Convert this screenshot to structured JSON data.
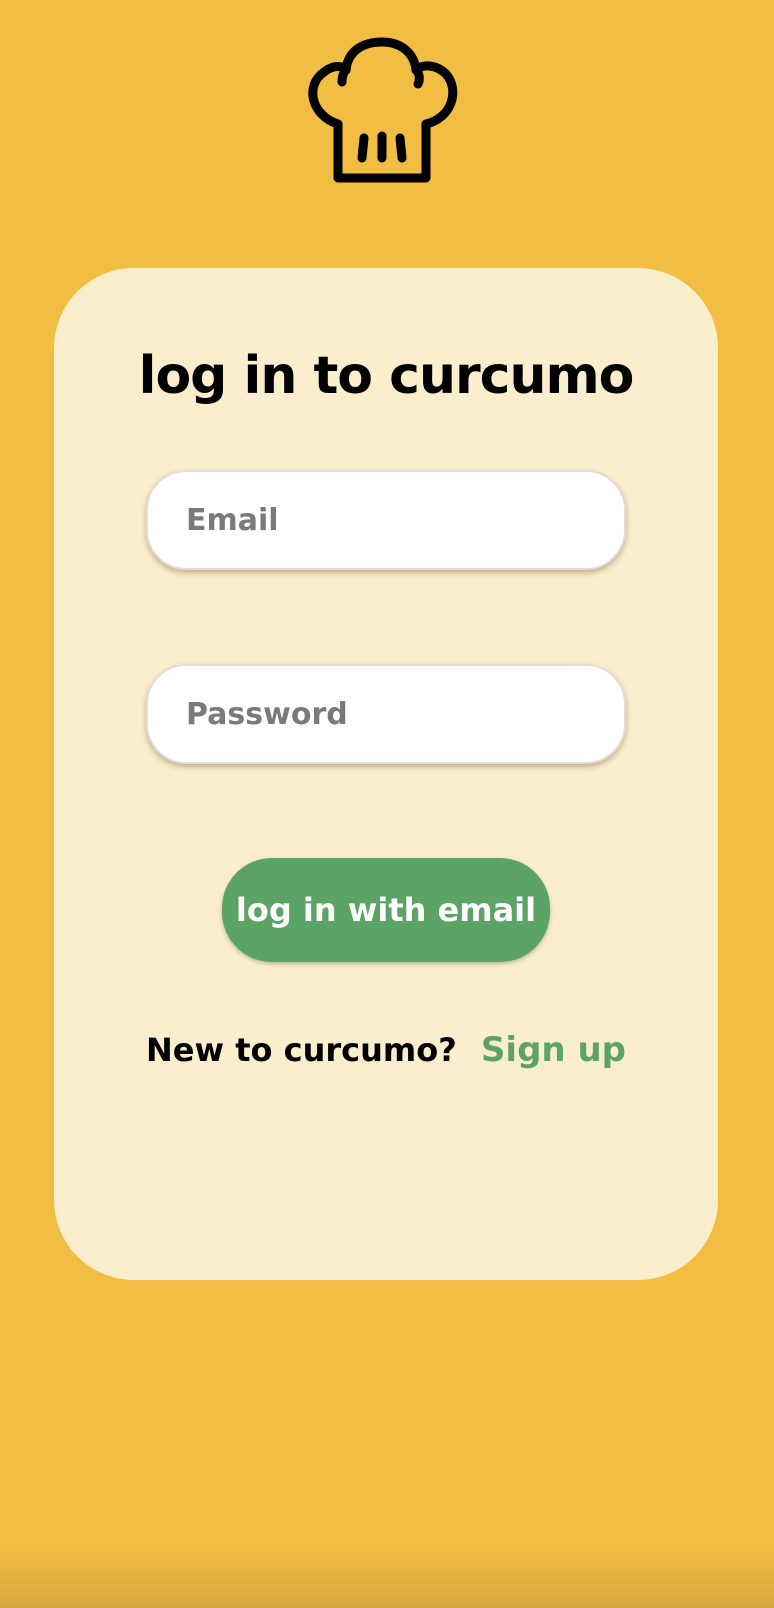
{
  "logo": {
    "icon": "chef-hat-icon"
  },
  "login": {
    "title": "log in to curcumo",
    "email_placeholder": "Email",
    "email_value": "",
    "password_placeholder": "Password",
    "password_value": "",
    "submit_label": "log in with email",
    "signup_prompt": "New to curcumo?",
    "signup_link": "Sign up"
  },
  "colors": {
    "background": "#F1BD42",
    "card": "#FBEECD",
    "accent_green": "#5BA466",
    "text": "#000000",
    "placeholder": "#7A7A7A"
  }
}
